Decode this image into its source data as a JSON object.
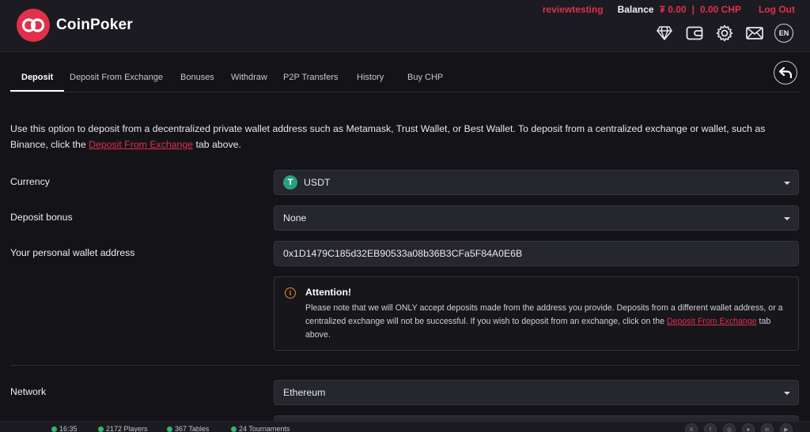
{
  "header": {
    "brand": "CoinPoker",
    "username": "reviewtesting",
    "balance_label": "Balance",
    "balance_usdt": "₮ 0.00",
    "separator": "|",
    "balance_chp": "0.00 CHP",
    "logout": "Log Out",
    "language": "EN",
    "icons": [
      "diamond-icon",
      "wallet-icon",
      "gear-icon",
      "mail-icon",
      "language-icon"
    ]
  },
  "tabs": [
    "Deposit",
    "Deposit From Exchange",
    "Bonuses",
    "Withdraw",
    "P2P Transfers",
    "History",
    "Buy CHP"
  ],
  "active_tab": "Deposit",
  "intro": {
    "text_before": "Use this option to deposit from a decentralized private wallet address such as Metamask, Trust Wallet, or Best Wallet. To deposit from a centralized exchange or wallet, such as Binance, click the ",
    "link": "Deposit From Exchange",
    "text_after": " tab above."
  },
  "form": {
    "currency_label": "Currency",
    "currency_value": "USDT",
    "currency_symbol": "T",
    "bonus_label": "Deposit bonus",
    "bonus_value": "None",
    "wallet_label": "Your personal wallet address",
    "wallet_value": "0x1D1479C185d32EB90533a08b36B3CFa5F84A0E6B",
    "network_label": "Network",
    "network_value": "Ethereum"
  },
  "attention": {
    "icon_glyph": "i",
    "title": "Attention!",
    "text_before": "Please note that we will ONLY accept deposits made from the address you provide. Deposits from a different wallet address, or a centralized exchange will not be successful. If you wish to deposit from an exchange, click on the ",
    "link": "Deposit From Exchange",
    "text_after": " tab above."
  },
  "footer": {
    "time": "16:35",
    "players": "2172 Players",
    "tables": "367 Tables",
    "tournaments": "24 Tournaments",
    "social": [
      "X",
      "f",
      "◎",
      "●",
      "in",
      "▶"
    ]
  },
  "colors": {
    "accent": "#e0304a",
    "warning": "#f08a24",
    "tether": "#26a17b",
    "background": "#141418"
  }
}
